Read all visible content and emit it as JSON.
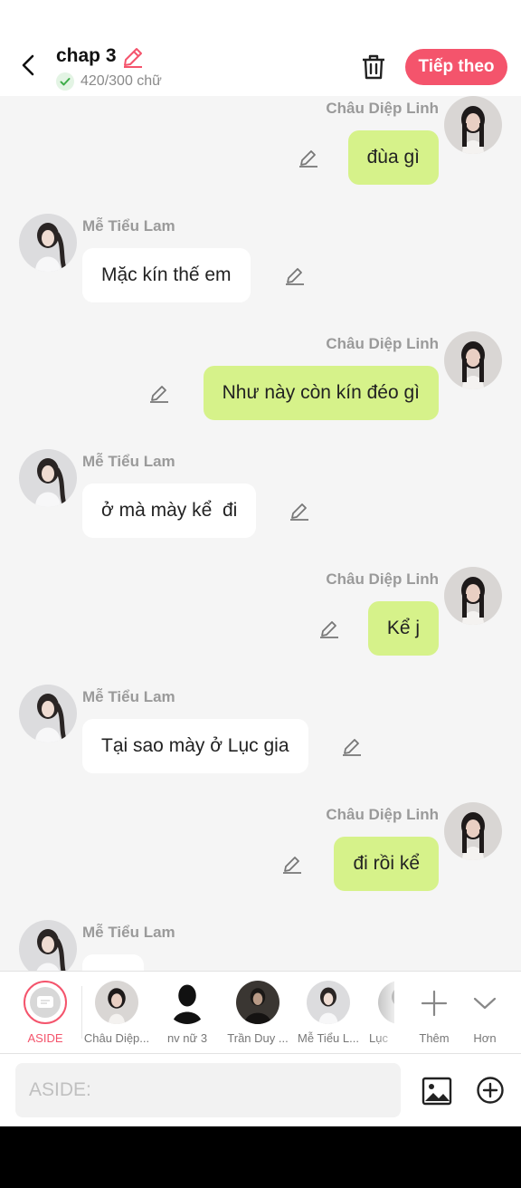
{
  "header": {
    "title": "chap 3",
    "word_count": "420/300 chữ",
    "next_label": "Tiếp theo"
  },
  "messages": [
    {
      "sender": "Châu Diệp Linh",
      "text": "đùa gì",
      "side": "right"
    },
    {
      "sender": "Mễ Tiểu Lam",
      "text": "Mặc kín thế em",
      "side": "left"
    },
    {
      "sender": "Châu Diệp Linh",
      "text": "Như này còn kín đéo gì",
      "side": "right"
    },
    {
      "sender": "Mễ Tiểu Lam",
      "text": "ở mà mày kể  đi",
      "side": "left"
    },
    {
      "sender": "Châu Diệp Linh",
      "text": "Kể j",
      "side": "right"
    },
    {
      "sender": "Mễ Tiểu Lam",
      "text": "Tại sao mày ở Lục gia",
      "side": "left"
    },
    {
      "sender": "Châu Diệp Linh",
      "text": "đi rồi kể",
      "side": "right"
    },
    {
      "sender": "Mễ Tiểu Lam",
      "text": "",
      "side": "left"
    }
  ],
  "characters": {
    "aside_label": "ASIDE",
    "items": [
      {
        "name": "Châu Diệp..."
      },
      {
        "name": "nv nữ 3"
      },
      {
        "name": "Trần Duy ..."
      },
      {
        "name": "Mễ Tiểu L..."
      },
      {
        "name": "Lục"
      }
    ],
    "add_label": "Thêm",
    "more_label": "Hơn"
  },
  "composer": {
    "placeholder": "ASIDE:"
  },
  "colors": {
    "accent": "#f4546c",
    "bubble_right": "#d6f28a",
    "bubble_left": "#ffffff",
    "background": "#f5f5f5"
  },
  "icons": [
    "back-arrow-icon",
    "pencil-icon",
    "check-icon",
    "trash-icon",
    "pencil-icon",
    "plus-icon",
    "chevron-down-icon",
    "image-icon",
    "add-circle-icon"
  ]
}
